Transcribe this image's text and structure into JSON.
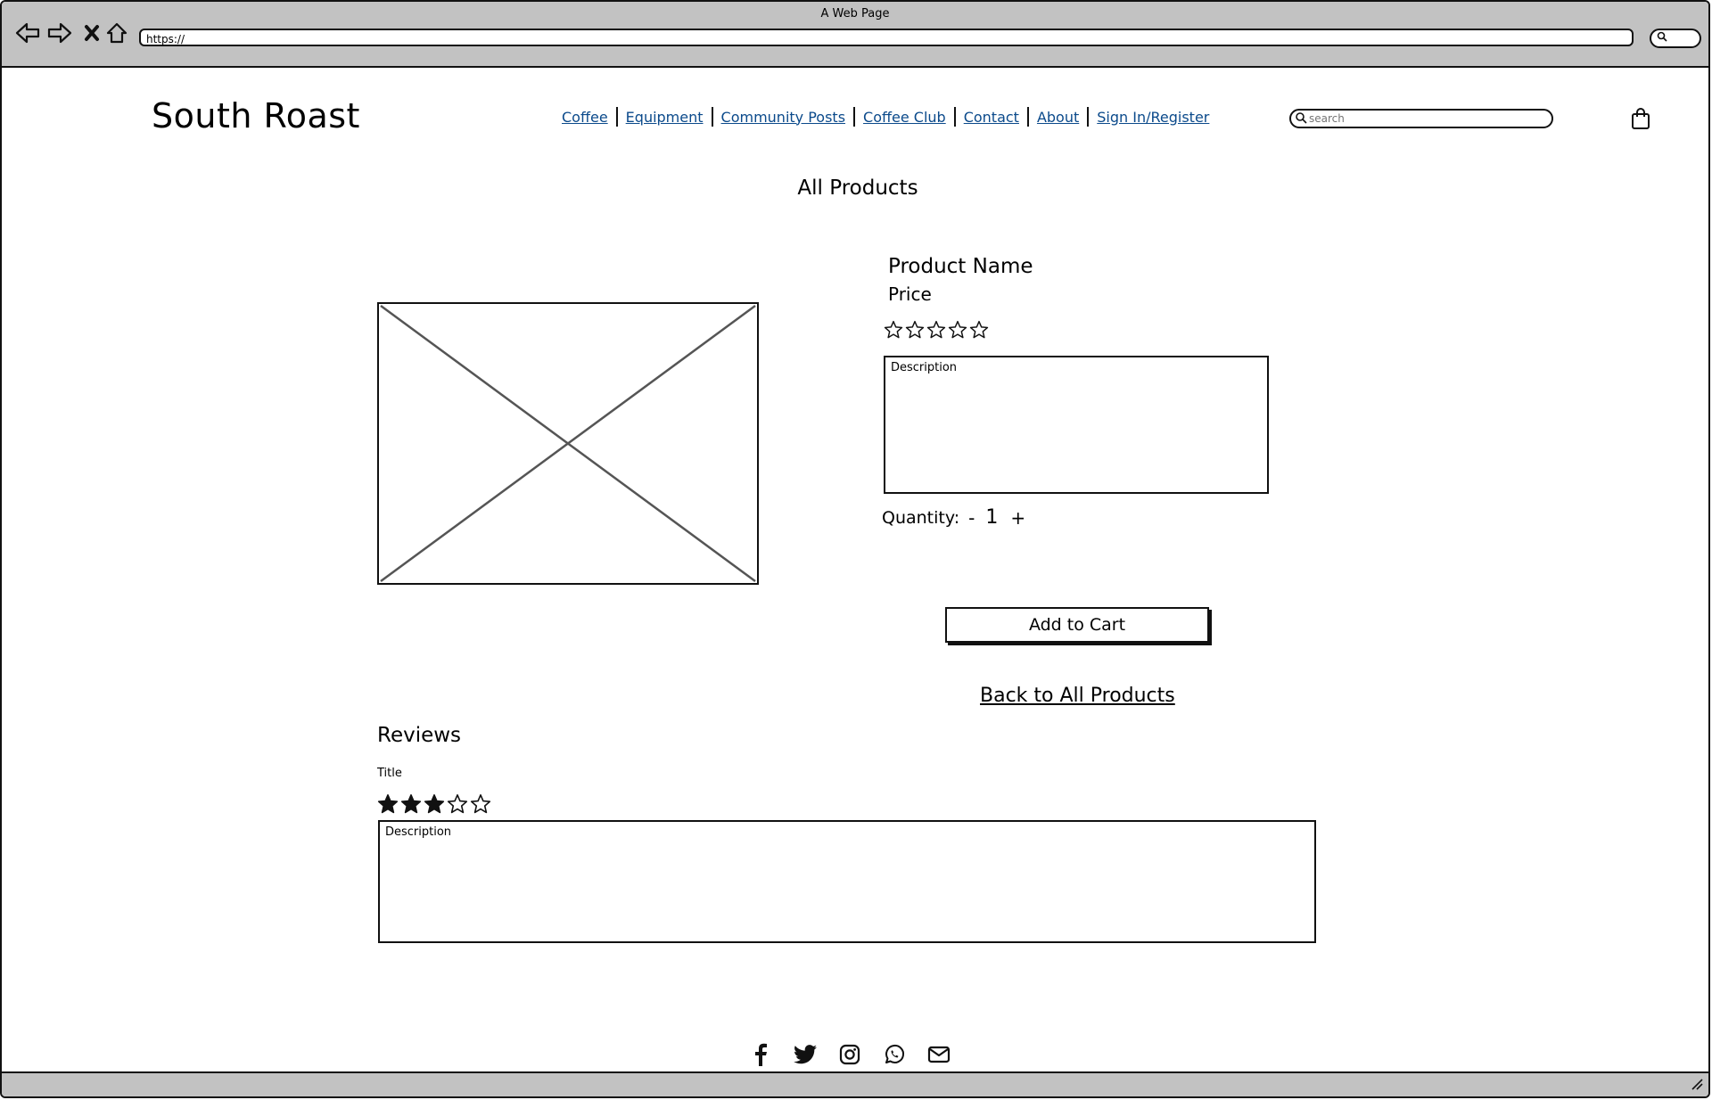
{
  "browser": {
    "window_title": "A Web Page",
    "url": "https://"
  },
  "header": {
    "logo": "South Roast",
    "nav": [
      "Coffee",
      "Equipment",
      "Community Posts",
      "Coffee Club",
      "Contact",
      "About",
      "Sign In/Register"
    ],
    "search_placeholder": "search"
  },
  "page": {
    "heading": "All Products"
  },
  "product": {
    "name": "Product Name",
    "price": "Price",
    "rating": 0,
    "rating_max": 5,
    "description": "Description",
    "quantity_label": "Quantity:",
    "quantity_decrement": "-",
    "quantity_value": "1",
    "quantity_increment": "+",
    "add_to_cart": "Add to Cart",
    "back_link": "Back to All Products"
  },
  "reviews": {
    "heading": "Reviews",
    "items": [
      {
        "title": "Title",
        "rating": 3,
        "rating_max": 5,
        "description": "Description"
      }
    ]
  },
  "footer": {
    "social_icons": [
      "facebook-icon",
      "twitter-icon",
      "instagram-icon",
      "whatsapp-icon",
      "email-icon"
    ]
  }
}
